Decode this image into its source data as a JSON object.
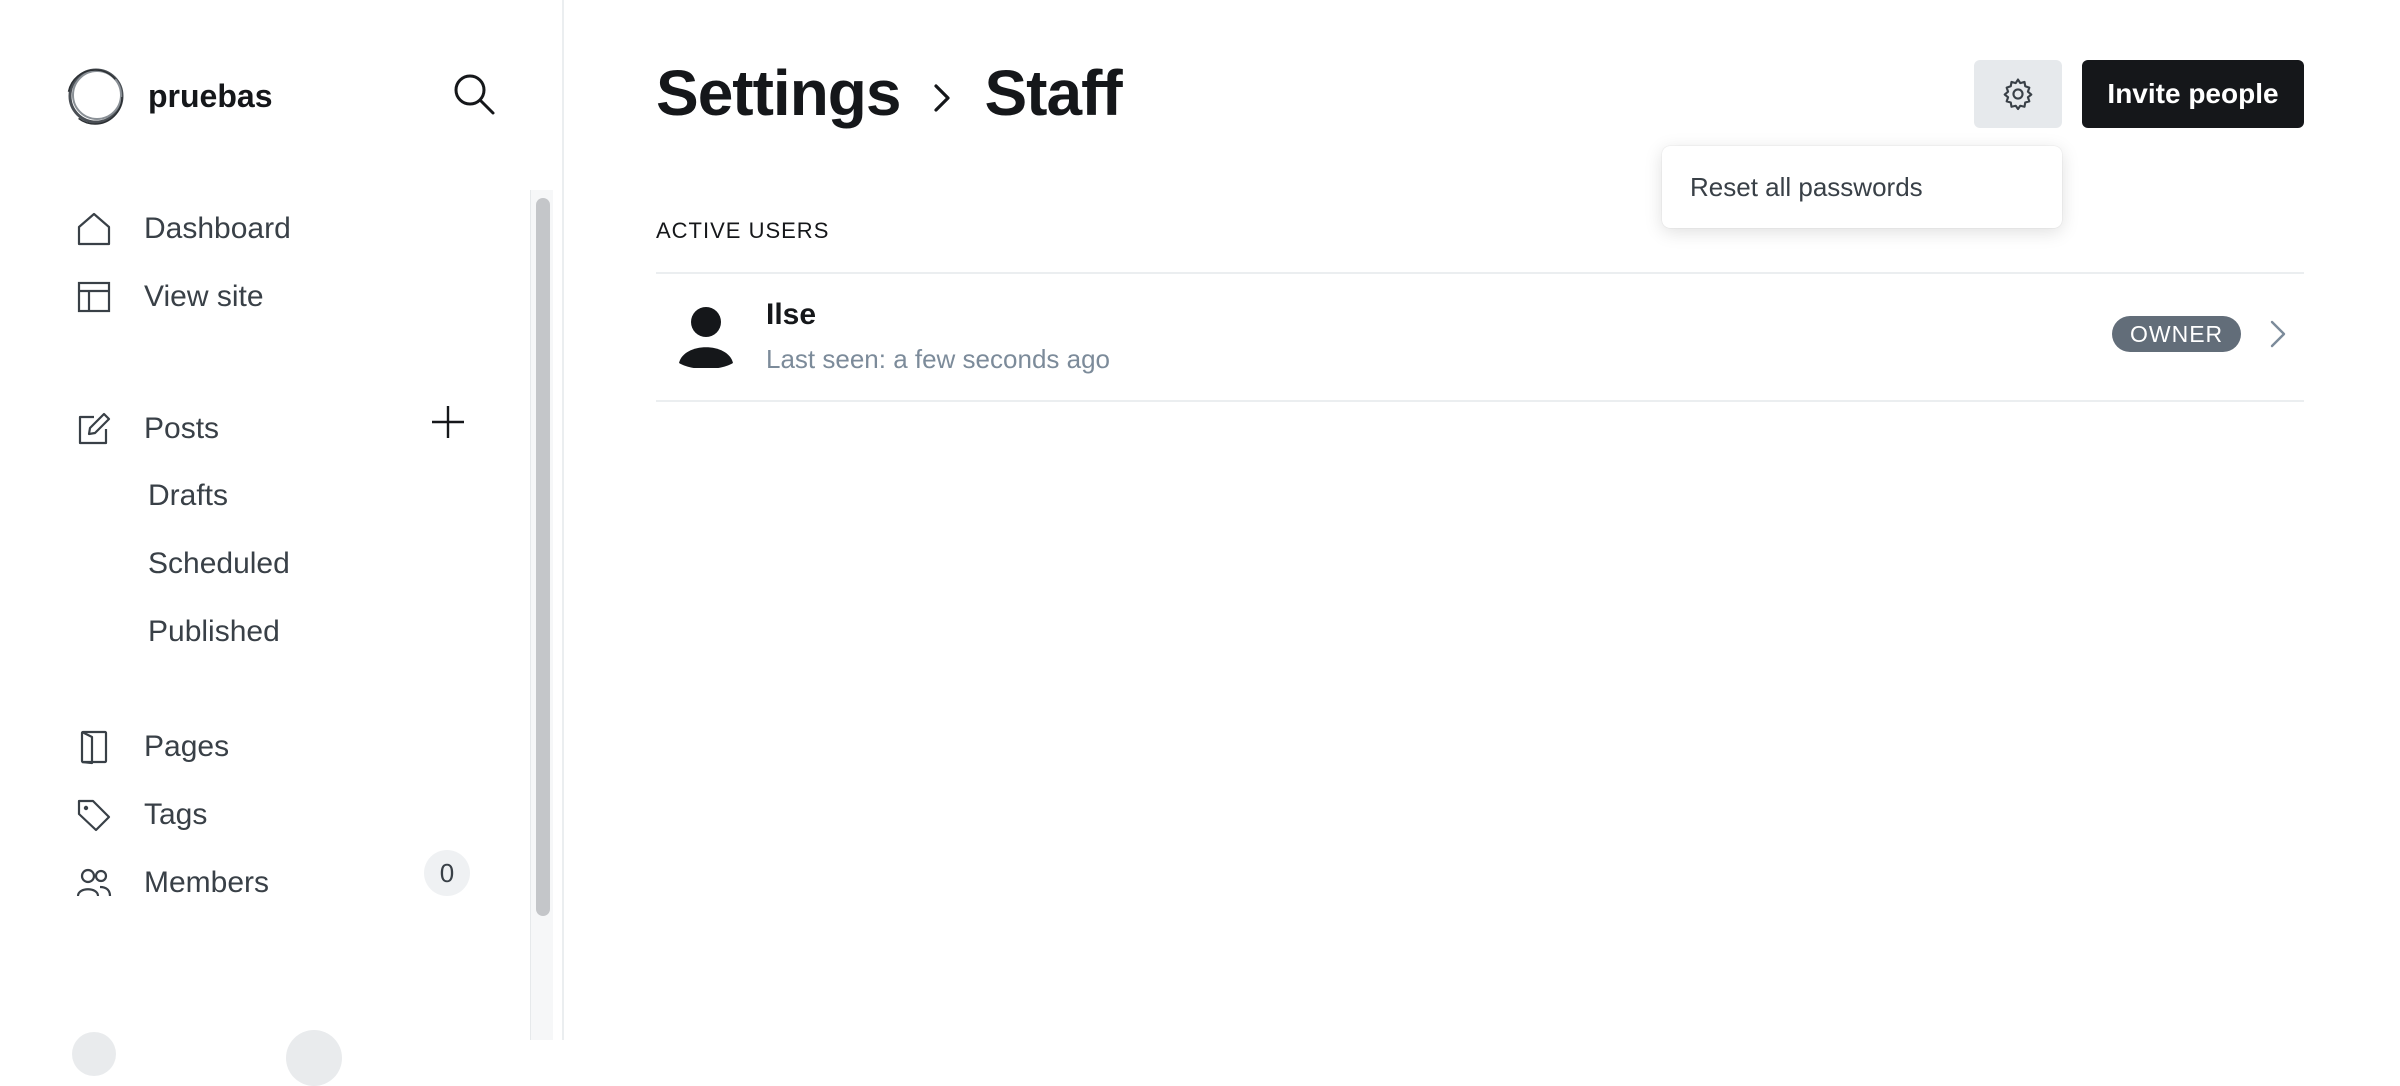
{
  "sidebar": {
    "site_name": "pruebas",
    "nav": {
      "dashboard": "Dashboard",
      "view_site": "View site",
      "posts": "Posts",
      "pages": "Pages",
      "tags": "Tags",
      "members": "Members"
    },
    "post_subitems": {
      "drafts": "Drafts",
      "scheduled": "Scheduled",
      "published": "Published"
    },
    "members_count": "0"
  },
  "header": {
    "breadcrumb_parent": "Settings",
    "breadcrumb_current": "Staff",
    "invite_label": "Invite people"
  },
  "settings_menu": {
    "reset_passwords": "Reset all passwords"
  },
  "staff": {
    "section_title": "ACTIVE USERS",
    "users": [
      {
        "name": "Ilse",
        "last_seen": "Last seen: a few seconds ago",
        "role": "OWNER"
      }
    ]
  },
  "colors": {
    "text_primary": "#15171a",
    "text_secondary": "#394047",
    "muted": "#7c8b9a",
    "invite_button_bg": "#15171a",
    "gear_button_bg": "#e6e9ec",
    "role_badge_bg": "#626d79"
  },
  "icons": {
    "logo": "ring-logo-icon",
    "search": "search-icon",
    "dashboard": "home-icon",
    "view_site": "layout-icon",
    "posts": "edit-icon",
    "add_post": "plus-icon",
    "pages": "page-icon",
    "tags": "tag-icon",
    "members": "users-icon",
    "breadcrumb": "chevron-right-icon",
    "settings": "gear-icon",
    "avatar": "person-icon",
    "row": "chevron-right-icon"
  }
}
